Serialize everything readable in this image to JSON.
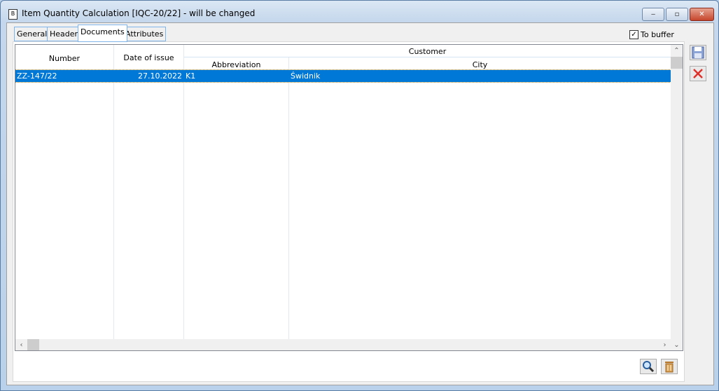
{
  "window": {
    "title": "Item Quantity Calculation [IQC-20/22] - will be changed",
    "minimize_label": "‒",
    "maximize_label": "▫",
    "close_label": "✕"
  },
  "tabs": [
    {
      "label": "General",
      "active": false
    },
    {
      "label": "Header",
      "active": false
    },
    {
      "label": "Documents",
      "active": true
    },
    {
      "label": "Attributes",
      "active": false
    }
  ],
  "to_buffer": {
    "label": "To buffer",
    "checked": true,
    "check_glyph": "✓"
  },
  "table": {
    "columns": {
      "number": "Number",
      "date_of_issue": "Date of issue",
      "customer_group": "Customer",
      "abbreviation": "Abbreviation",
      "city": "City"
    },
    "rows": [
      {
        "number": "ZZ-147/22",
        "date_of_issue": "27.10.2022",
        "abbreviation": "K1",
        "city": "Świdnik",
        "selected": true
      }
    ]
  },
  "scroll": {
    "up": "⌃",
    "down": "⌄",
    "left": "‹",
    "right": "›"
  },
  "colors": {
    "selection": "#0078d7",
    "tab_border": "#7eb4ea",
    "close_red": "#c5462c"
  }
}
